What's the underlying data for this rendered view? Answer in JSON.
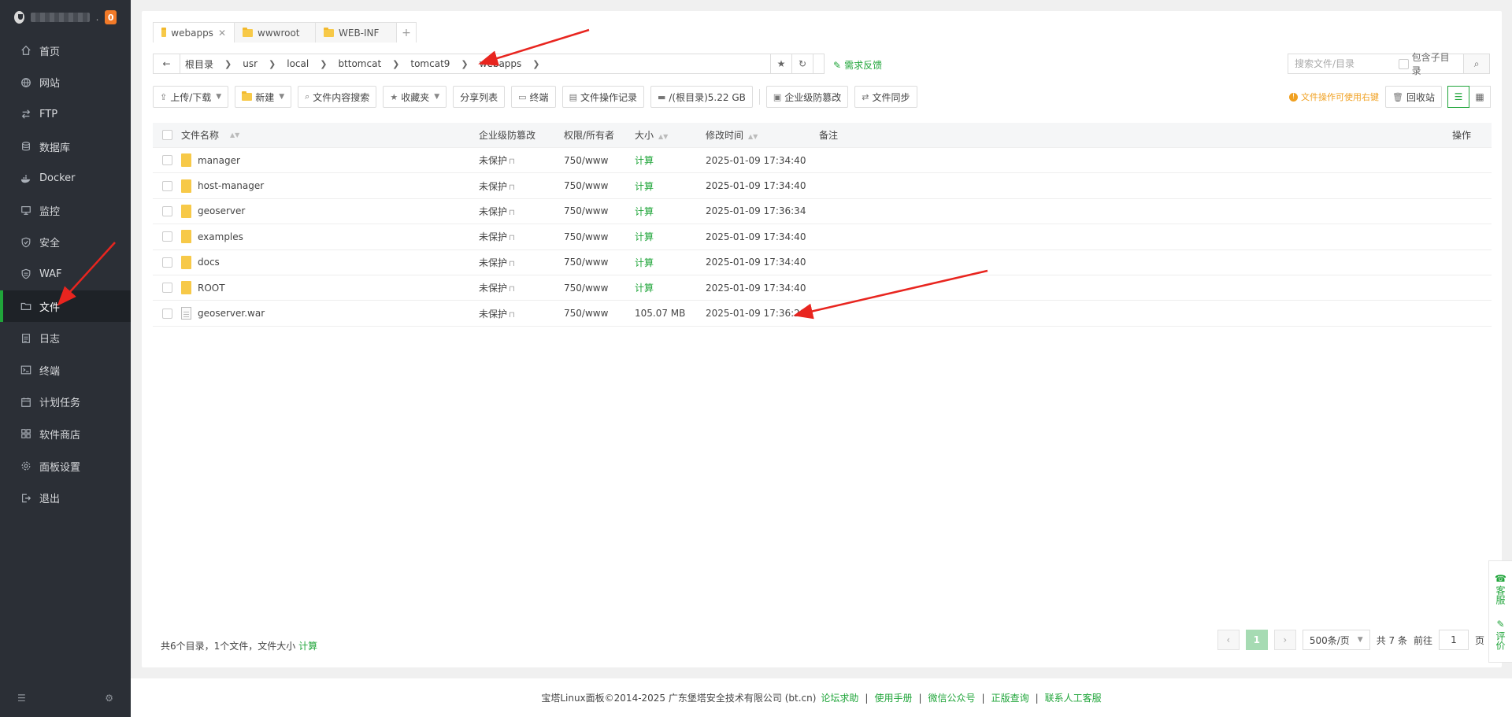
{
  "sidebar": {
    "badge": "0",
    "host_suffix": ".",
    "items": [
      {
        "label": "首页",
        "icon": "home-icon"
      },
      {
        "label": "网站",
        "icon": "globe-icon"
      },
      {
        "label": "FTP",
        "icon": "ftp-icon"
      },
      {
        "label": "数据库",
        "icon": "database-icon"
      },
      {
        "label": "Docker",
        "icon": "docker-icon"
      },
      {
        "label": "监控",
        "icon": "monitor-icon"
      },
      {
        "label": "安全",
        "icon": "shield-icon"
      },
      {
        "label": "WAF",
        "icon": "waf-icon"
      },
      {
        "label": "文件",
        "icon": "folder-icon",
        "active": true
      },
      {
        "label": "日志",
        "icon": "log-icon"
      },
      {
        "label": "终端",
        "icon": "terminal-icon"
      },
      {
        "label": "计划任务",
        "icon": "clock-icon"
      },
      {
        "label": "软件商店",
        "icon": "apps-icon"
      },
      {
        "label": "面板设置",
        "icon": "gear-icon"
      },
      {
        "label": "退出",
        "icon": "logout-icon"
      }
    ]
  },
  "tabs": [
    {
      "label": "webapps",
      "active": true,
      "closable": true
    },
    {
      "label": "wwwroot"
    },
    {
      "label": "WEB-INF"
    }
  ],
  "tab_add": "+",
  "path": {
    "crumbs": [
      "根目录",
      "usr",
      "local",
      "bttomcat",
      "tomcat9",
      "webapps"
    ],
    "feedback": "需求反馈"
  },
  "search": {
    "placeholder": "搜索文件/目录",
    "include_sub": "包含子目录"
  },
  "toolbar": {
    "upload": "上传/下载",
    "new": "新建",
    "content_search": "文件内容搜索",
    "favorites": "收藏夹",
    "share_list": "分享列表",
    "terminal": "终端",
    "op_log": "文件操作记录",
    "disk": "/(根目录)5.22 GB",
    "tamper": "企业级防篡改",
    "sync": "文件同步",
    "tip": "文件操作可使用右键",
    "recycle": "回收站"
  },
  "table": {
    "headers": {
      "name": "文件名称",
      "protect": "企业级防篡改",
      "perm": "权限/所有者",
      "size": "大小",
      "mtime": "修改时间",
      "note": "备注",
      "op": "操作"
    },
    "rows": [
      {
        "name": "manager",
        "type": "folder",
        "protect": "未保护",
        "perm": "750/www",
        "size": "计算",
        "mtime": "2025-01-09 17:34:40"
      },
      {
        "name": "host-manager",
        "type": "folder",
        "protect": "未保护",
        "perm": "750/www",
        "size": "计算",
        "mtime": "2025-01-09 17:34:40"
      },
      {
        "name": "geoserver",
        "type": "folder",
        "protect": "未保护",
        "perm": "750/www",
        "size": "计算",
        "mtime": "2025-01-09 17:36:34"
      },
      {
        "name": "examples",
        "type": "folder",
        "protect": "未保护",
        "perm": "750/www",
        "size": "计算",
        "mtime": "2025-01-09 17:34:40"
      },
      {
        "name": "docs",
        "type": "folder",
        "protect": "未保护",
        "perm": "750/www",
        "size": "计算",
        "mtime": "2025-01-09 17:34:40"
      },
      {
        "name": "ROOT",
        "type": "folder",
        "protect": "未保护",
        "perm": "750/www",
        "size": "计算",
        "mtime": "2025-01-09 17:34:40"
      },
      {
        "name": "geoserver.war",
        "type": "file",
        "protect": "未保护",
        "perm": "750/www",
        "size": "105.07 MB",
        "mtime": "2025-01-09 17:36:29"
      }
    ]
  },
  "summary": {
    "text": "共6个目录，1个文件，文件大小",
    "calc": "计算"
  },
  "pager": {
    "current": "1",
    "per_page": "500条/页",
    "total": "共 7 条",
    "goto_prefix": "前往",
    "goto_value": "1",
    "goto_suffix": "页"
  },
  "float_panel": {
    "service": "客服",
    "rate": "评价"
  },
  "footer": {
    "copyright": "宝塔Linux面板©2014-2025 广东堡塔安全技术有限公司 (bt.cn)",
    "links": [
      "论坛求助",
      "使用手册",
      "微信公众号",
      "正版查询",
      "联系人工客服"
    ]
  },
  "colors": {
    "accent": "#20a53a",
    "sidebar_bg": "#2b2f36",
    "arrow": "#e8251f"
  }
}
